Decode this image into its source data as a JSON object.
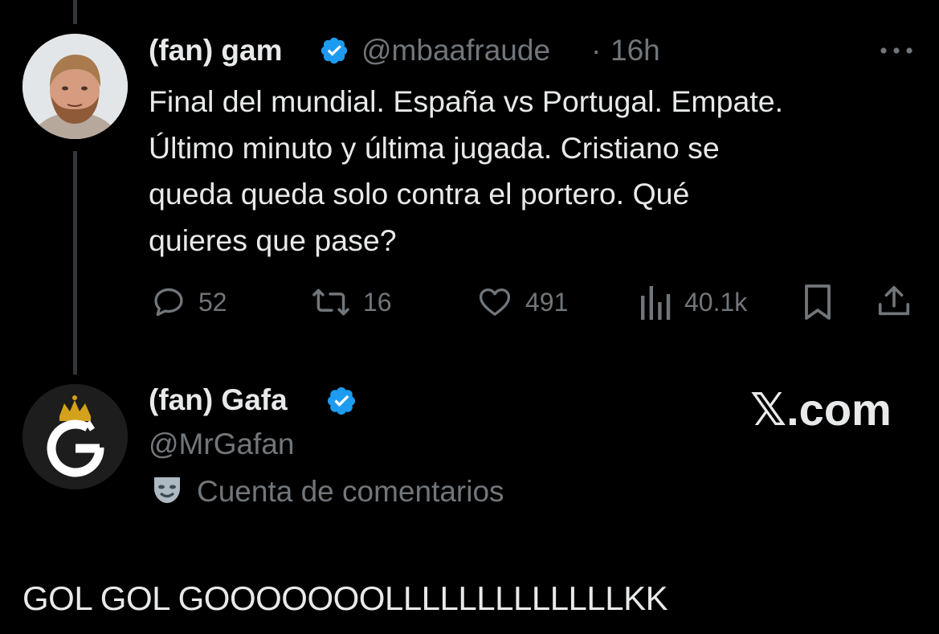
{
  "tweet": {
    "author_name": "(fan) gam",
    "handle": "@mbaafraude",
    "separator": "·",
    "time": "16h",
    "text_lines": [
      "Final del mundial. España vs Portugal. Empate.",
      "Último minuto y última jugada. Cristiano se",
      "queda queda solo contra el portero. Qué",
      "quieres que pase?"
    ],
    "stats": {
      "replies": "52",
      "reposts": "16",
      "likes": "491",
      "views": "40.1k"
    }
  },
  "reply_card": {
    "author_name": "(fan) Gafa",
    "handle": "@MrGafan",
    "account_label": "Cuenta de comentarios",
    "watermark": "𝕏.com"
  },
  "reply_text": "GOL GOL GOOOOOOOLLLLLLLLLLLLLKK",
  "colors": {
    "background": "#000000",
    "text": "#e7e9ea",
    "muted": "#71767b",
    "verified": "#1d9bf0",
    "thread_line": "#333639"
  },
  "icons": {
    "verified": "verified-badge-icon",
    "more": "more-dots-icon",
    "reply": "speech-bubble-icon",
    "repost": "repost-arrows-icon",
    "like": "heart-icon",
    "views": "bar-chart-icon",
    "bookmark": "bookmark-icon",
    "share": "share-icon",
    "label": "theater-mask-icon"
  }
}
